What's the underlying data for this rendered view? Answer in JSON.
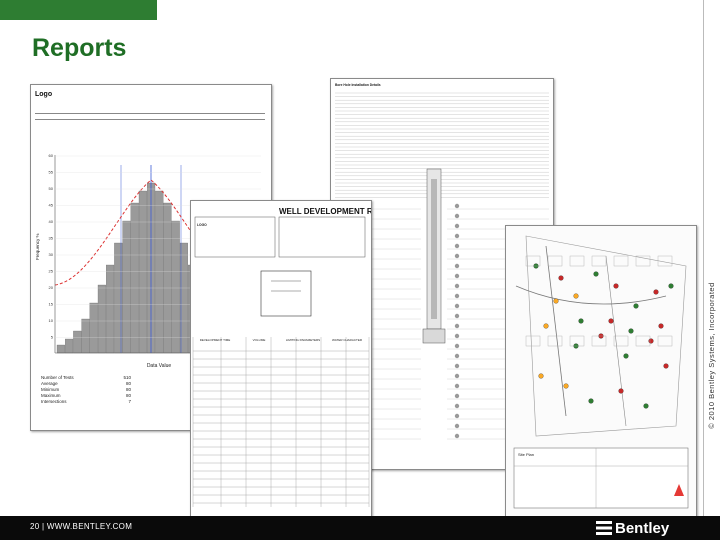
{
  "slide": {
    "title": "Reports",
    "footer": "20 | WWW.BENTLEY.COM",
    "copyright": "© 2010 Bentley Systems, Incorporated",
    "logo_text": "Bentley",
    "accent": "#1f6e25",
    "tab_color": "#2e7d32"
  },
  "report_histogram": {
    "logo_label": "Logo",
    "x_axis_label": "Data Value",
    "y_axis_label": "Frequency %",
    "y_ticks": [
      "60",
      "55",
      "50",
      "45",
      "40",
      "35",
      "30",
      "25",
      "20",
      "15",
      "10",
      "5"
    ],
    "stats": [
      {
        "label": "Number of Tests",
        "value": "510"
      },
      {
        "label": "Average",
        "value": "80"
      },
      {
        "label": "Minimum",
        "value": "80"
      },
      {
        "label": "Maximum",
        "value": "80"
      },
      {
        "label": "Intersections",
        "value": "7"
      }
    ]
  },
  "report_log": {
    "header": "Bore Hole Installation Details"
  },
  "report_well": {
    "title": "WELL DEVELOPMENT REC",
    "logo_label": "LOGO",
    "table_headers": [
      "DEVELOPMENT TIME",
      "VOLUME",
      "LIMITING PARAMETERS",
      "WATER CHARACTER"
    ]
  },
  "report_map": {
    "header": "Site Plan"
  }
}
